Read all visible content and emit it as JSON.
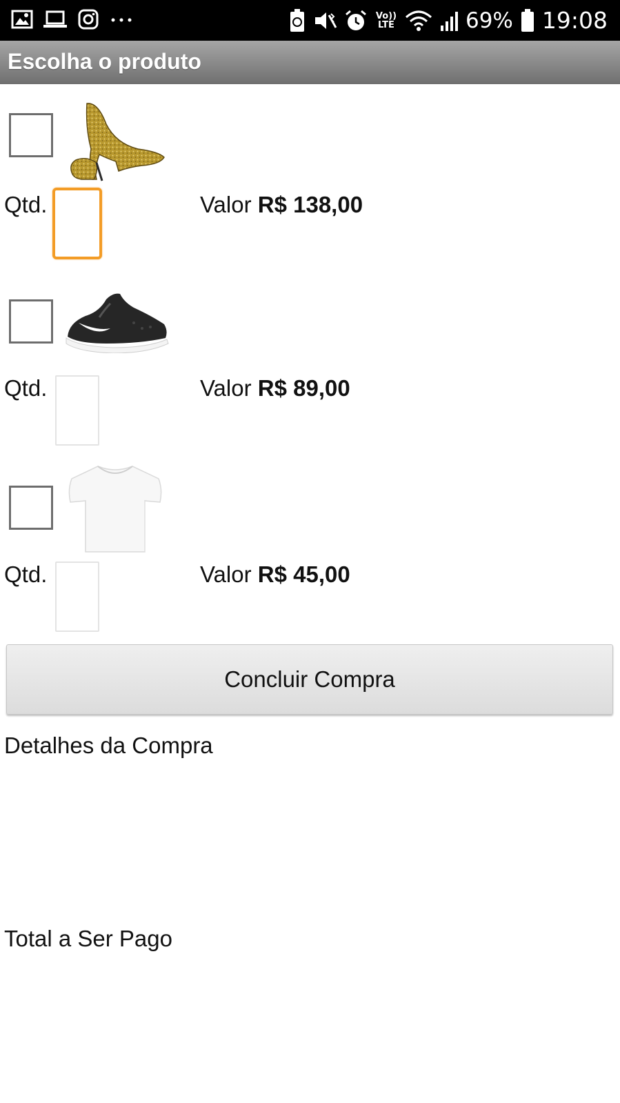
{
  "status_bar": {
    "left_icons": [
      "gallery-icon",
      "laptop-icon",
      "instagram-icon",
      "more-dots-icon"
    ],
    "right_icons": [
      "battery-saver-icon",
      "vibrate-icon",
      "alarm-icon",
      "volte-icon",
      "wifi-icon",
      "signal-icon",
      "battery-icon"
    ],
    "volte_label": "Vo))\nLTE",
    "battery_percent": "69%",
    "time": "19:08"
  },
  "header": {
    "title": "Escolha o produto",
    "gradient_top": "#a6a6a6",
    "gradient_bottom": "#6f6f6f"
  },
  "products": [
    {
      "image_icon": "gold-high-heel-shoe-image",
      "checked": false,
      "qty_label": "Qtd.",
      "qty_value": "",
      "qty_focused": true,
      "price_prefix": "Valor",
      "price": "R$ 138,00"
    },
    {
      "image_icon": "black-sneaker-image",
      "checked": false,
      "qty_label": "Qtd.",
      "qty_value": "",
      "qty_focused": false,
      "price_prefix": "Valor",
      "price": "R$ 89,00"
    },
    {
      "image_icon": "white-tshirt-image",
      "checked": false,
      "qty_label": "Qtd.",
      "qty_value": "",
      "qty_focused": false,
      "price_prefix": "Valor",
      "price": "R$ 45,00"
    }
  ],
  "actions": {
    "concluir_label": "Concluir Compra"
  },
  "details": {
    "label": "Detalhes da Compra"
  },
  "total": {
    "label": "Total a Ser Pago"
  },
  "colors": {
    "focus_accent": "#f39c26",
    "status_bar_bg": "#000000"
  }
}
